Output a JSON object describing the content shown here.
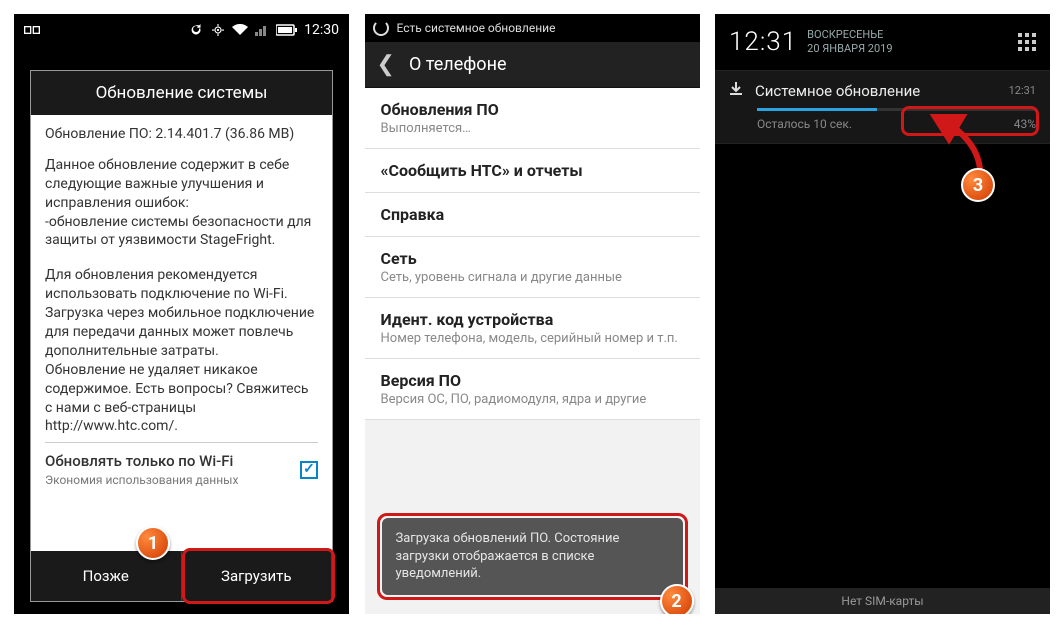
{
  "screen1": {
    "status_time": "12:30",
    "dialog_title": "Обновление системы",
    "update_version": "Обновление ПО: 2.14.401.7 (36.86 MB)",
    "desc": "Данное обновление содержит в себе следующие важные улучшения и исправления ошибок:\n  -обновление системы безопасности для защиты от уязвимости StageFright.",
    "recommend": "Для обновления рекомендуется использовать подключение по Wi-Fi. Загрузка через мобильное подключение для передачи данных может повлечь дополнительные затраты.\nОбновление не удаляет никакое содержимое. Есть вопросы? Свяжитесь с нами с веб-страницы http://www.htc.com/.",
    "wifi_only_label": "Обновлять только по Wi-Fi",
    "wifi_only_sub": "Экономия использования данных",
    "wifi_checked": true,
    "btn_later": "Позже",
    "btn_download": "Загрузить",
    "badge": "1"
  },
  "screen2": {
    "status_text": "Есть системное обновление",
    "header_title": "О телефоне",
    "items": [
      {
        "title": "Обновления ПО",
        "sub": "Выполняется…"
      },
      {
        "title": "«Сообщить HTC» и отчеты",
        "sub": ""
      },
      {
        "title": "Справка",
        "sub": ""
      },
      {
        "title": "Сеть",
        "sub": "Сеть, уровень сигнала и другие данные"
      },
      {
        "title": "Идент. код устройства",
        "sub": "Номер телефона, модель, серийный номер и т.п."
      },
      {
        "title": "Версия ПО",
        "sub": "Версия ОС, ПО, радиомодуля, ядра и другие"
      }
    ],
    "toast": "Загрузка обновлений ПО. Состояние загрузки отображается в списке уведомлений.",
    "badge": "2"
  },
  "screen3": {
    "time": "12:31",
    "day": "ВОСКРЕСЕНЬЕ",
    "date": "20 ЯНВАРЯ 2019",
    "notif_title": "Системное обновление",
    "notif_time": "12:31",
    "notif_remaining": "Осталось 10 сек.",
    "notif_percent": "43%",
    "progress_pct": 43,
    "bottom_text": "Нет SIM-карты",
    "badge": "3"
  }
}
